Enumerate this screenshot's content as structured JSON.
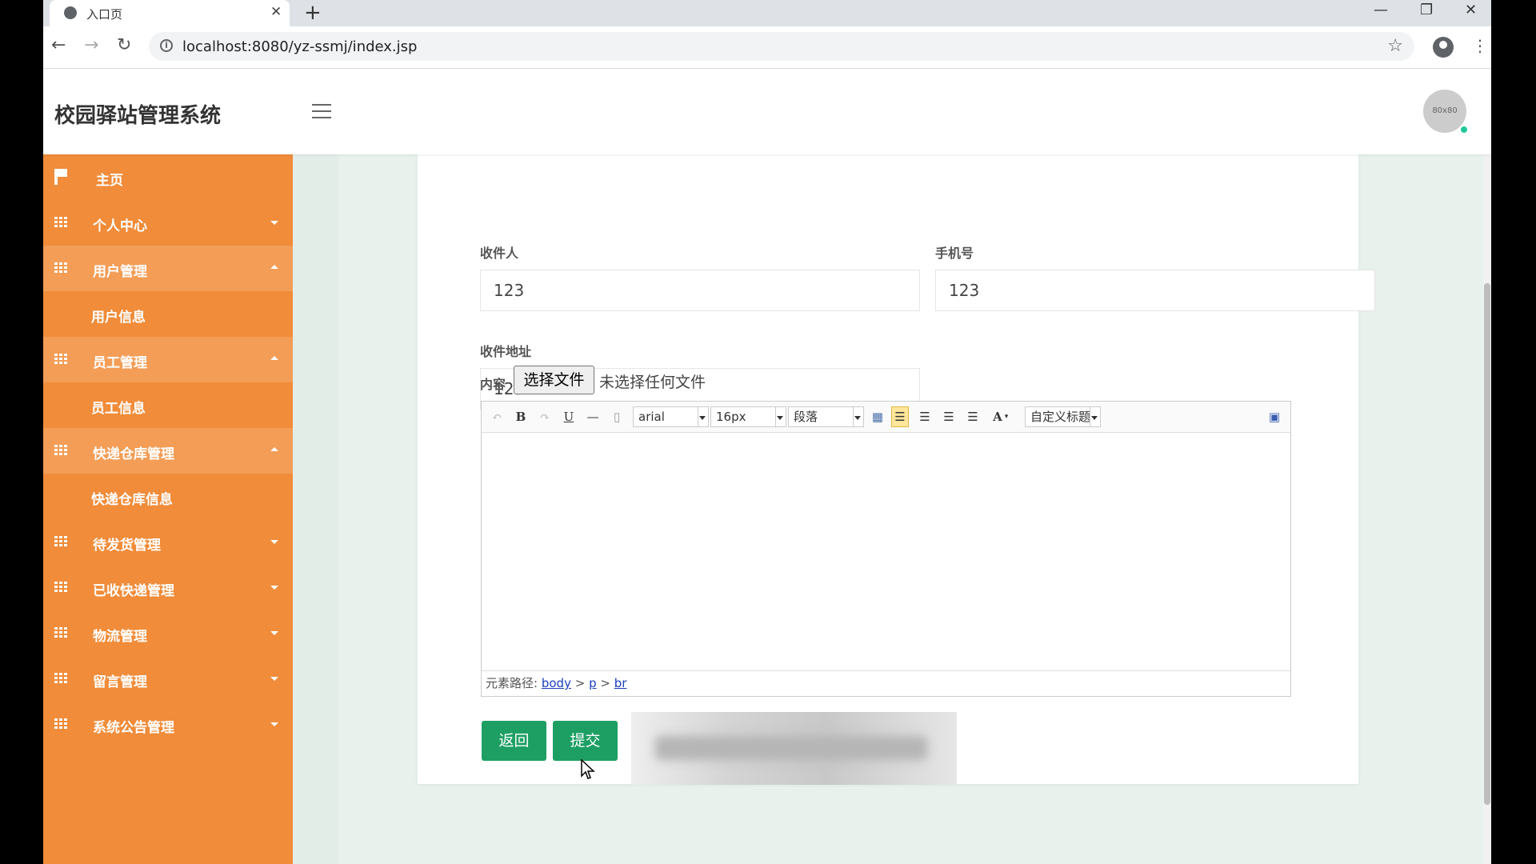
{
  "browser": {
    "tab_title": "入口页",
    "tab_close": "✕",
    "new_tab": "+",
    "url": "localhost:8080/yz-ssmj/index.jsp",
    "window_controls": {
      "minimize": "—",
      "restore": "❐",
      "close": "✕"
    }
  },
  "header": {
    "brand": "校园驿站管理系统",
    "avatar_text": "80x80"
  },
  "sidebar": {
    "home": "主页",
    "items": [
      {
        "label": "个人中心",
        "expanded": false
      },
      {
        "label": "用户管理",
        "expanded": true,
        "sub": "用户信息"
      },
      {
        "label": "员工管理",
        "expanded": true,
        "sub": "员工信息"
      },
      {
        "label": "快递仓库管理",
        "expanded": true,
        "sub": "快递仓库信息"
      },
      {
        "label": "待发货管理",
        "expanded": false
      },
      {
        "label": "已收快递管理",
        "expanded": false
      },
      {
        "label": "物流管理",
        "expanded": false
      },
      {
        "label": "留言管理",
        "expanded": false
      },
      {
        "label": "系统公告管理",
        "expanded": false
      }
    ]
  },
  "form": {
    "recipient_label": "收件人",
    "recipient_value": "123",
    "phone_label": "手机号",
    "phone_value": "123",
    "address_label": "收件地址",
    "address_value": "123",
    "content_label": "内容",
    "file_button": "选择文件",
    "file_status": "未选择任何文件"
  },
  "editor": {
    "font_family": "arial",
    "font_size": "16px",
    "paragraph": "段落",
    "custom_title": "自定义标题",
    "path_label": "元素路径:",
    "path": [
      "body",
      "p",
      "br"
    ],
    "path_sep": ">"
  },
  "actions": {
    "back": "返回",
    "submit": "提交"
  },
  "colors": {
    "sidebar": "#f08c3a",
    "button": "#1d9f63",
    "page_bg": "#e8f1ec"
  }
}
